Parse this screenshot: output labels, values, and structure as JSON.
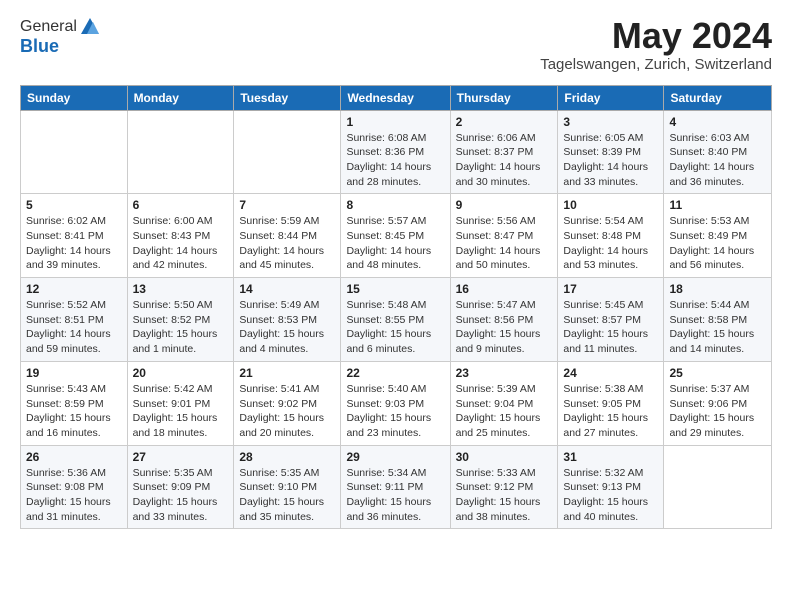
{
  "logo": {
    "general": "General",
    "blue": "Blue"
  },
  "title": "May 2024",
  "location": "Tagelswangen, Zurich, Switzerland",
  "days_of_week": [
    "Sunday",
    "Monday",
    "Tuesday",
    "Wednesday",
    "Thursday",
    "Friday",
    "Saturday"
  ],
  "weeks": [
    [
      {
        "num": "",
        "detail": ""
      },
      {
        "num": "",
        "detail": ""
      },
      {
        "num": "",
        "detail": ""
      },
      {
        "num": "1",
        "detail": "Sunrise: 6:08 AM\nSunset: 8:36 PM\nDaylight: 14 hours\nand 28 minutes."
      },
      {
        "num": "2",
        "detail": "Sunrise: 6:06 AM\nSunset: 8:37 PM\nDaylight: 14 hours\nand 30 minutes."
      },
      {
        "num": "3",
        "detail": "Sunrise: 6:05 AM\nSunset: 8:39 PM\nDaylight: 14 hours\nand 33 minutes."
      },
      {
        "num": "4",
        "detail": "Sunrise: 6:03 AM\nSunset: 8:40 PM\nDaylight: 14 hours\nand 36 minutes."
      }
    ],
    [
      {
        "num": "5",
        "detail": "Sunrise: 6:02 AM\nSunset: 8:41 PM\nDaylight: 14 hours\nand 39 minutes."
      },
      {
        "num": "6",
        "detail": "Sunrise: 6:00 AM\nSunset: 8:43 PM\nDaylight: 14 hours\nand 42 minutes."
      },
      {
        "num": "7",
        "detail": "Sunrise: 5:59 AM\nSunset: 8:44 PM\nDaylight: 14 hours\nand 45 minutes."
      },
      {
        "num": "8",
        "detail": "Sunrise: 5:57 AM\nSunset: 8:45 PM\nDaylight: 14 hours\nand 48 minutes."
      },
      {
        "num": "9",
        "detail": "Sunrise: 5:56 AM\nSunset: 8:47 PM\nDaylight: 14 hours\nand 50 minutes."
      },
      {
        "num": "10",
        "detail": "Sunrise: 5:54 AM\nSunset: 8:48 PM\nDaylight: 14 hours\nand 53 minutes."
      },
      {
        "num": "11",
        "detail": "Sunrise: 5:53 AM\nSunset: 8:49 PM\nDaylight: 14 hours\nand 56 minutes."
      }
    ],
    [
      {
        "num": "12",
        "detail": "Sunrise: 5:52 AM\nSunset: 8:51 PM\nDaylight: 14 hours\nand 59 minutes."
      },
      {
        "num": "13",
        "detail": "Sunrise: 5:50 AM\nSunset: 8:52 PM\nDaylight: 15 hours\nand 1 minute."
      },
      {
        "num": "14",
        "detail": "Sunrise: 5:49 AM\nSunset: 8:53 PM\nDaylight: 15 hours\nand 4 minutes."
      },
      {
        "num": "15",
        "detail": "Sunrise: 5:48 AM\nSunset: 8:55 PM\nDaylight: 15 hours\nand 6 minutes."
      },
      {
        "num": "16",
        "detail": "Sunrise: 5:47 AM\nSunset: 8:56 PM\nDaylight: 15 hours\nand 9 minutes."
      },
      {
        "num": "17",
        "detail": "Sunrise: 5:45 AM\nSunset: 8:57 PM\nDaylight: 15 hours\nand 11 minutes."
      },
      {
        "num": "18",
        "detail": "Sunrise: 5:44 AM\nSunset: 8:58 PM\nDaylight: 15 hours\nand 14 minutes."
      }
    ],
    [
      {
        "num": "19",
        "detail": "Sunrise: 5:43 AM\nSunset: 8:59 PM\nDaylight: 15 hours\nand 16 minutes."
      },
      {
        "num": "20",
        "detail": "Sunrise: 5:42 AM\nSunset: 9:01 PM\nDaylight: 15 hours\nand 18 minutes."
      },
      {
        "num": "21",
        "detail": "Sunrise: 5:41 AM\nSunset: 9:02 PM\nDaylight: 15 hours\nand 20 minutes."
      },
      {
        "num": "22",
        "detail": "Sunrise: 5:40 AM\nSunset: 9:03 PM\nDaylight: 15 hours\nand 23 minutes."
      },
      {
        "num": "23",
        "detail": "Sunrise: 5:39 AM\nSunset: 9:04 PM\nDaylight: 15 hours\nand 25 minutes."
      },
      {
        "num": "24",
        "detail": "Sunrise: 5:38 AM\nSunset: 9:05 PM\nDaylight: 15 hours\nand 27 minutes."
      },
      {
        "num": "25",
        "detail": "Sunrise: 5:37 AM\nSunset: 9:06 PM\nDaylight: 15 hours\nand 29 minutes."
      }
    ],
    [
      {
        "num": "26",
        "detail": "Sunrise: 5:36 AM\nSunset: 9:08 PM\nDaylight: 15 hours\nand 31 minutes."
      },
      {
        "num": "27",
        "detail": "Sunrise: 5:35 AM\nSunset: 9:09 PM\nDaylight: 15 hours\nand 33 minutes."
      },
      {
        "num": "28",
        "detail": "Sunrise: 5:35 AM\nSunset: 9:10 PM\nDaylight: 15 hours\nand 35 minutes."
      },
      {
        "num": "29",
        "detail": "Sunrise: 5:34 AM\nSunset: 9:11 PM\nDaylight: 15 hours\nand 36 minutes."
      },
      {
        "num": "30",
        "detail": "Sunrise: 5:33 AM\nSunset: 9:12 PM\nDaylight: 15 hours\nand 38 minutes."
      },
      {
        "num": "31",
        "detail": "Sunrise: 5:32 AM\nSunset: 9:13 PM\nDaylight: 15 hours\nand 40 minutes."
      },
      {
        "num": "",
        "detail": ""
      }
    ]
  ]
}
